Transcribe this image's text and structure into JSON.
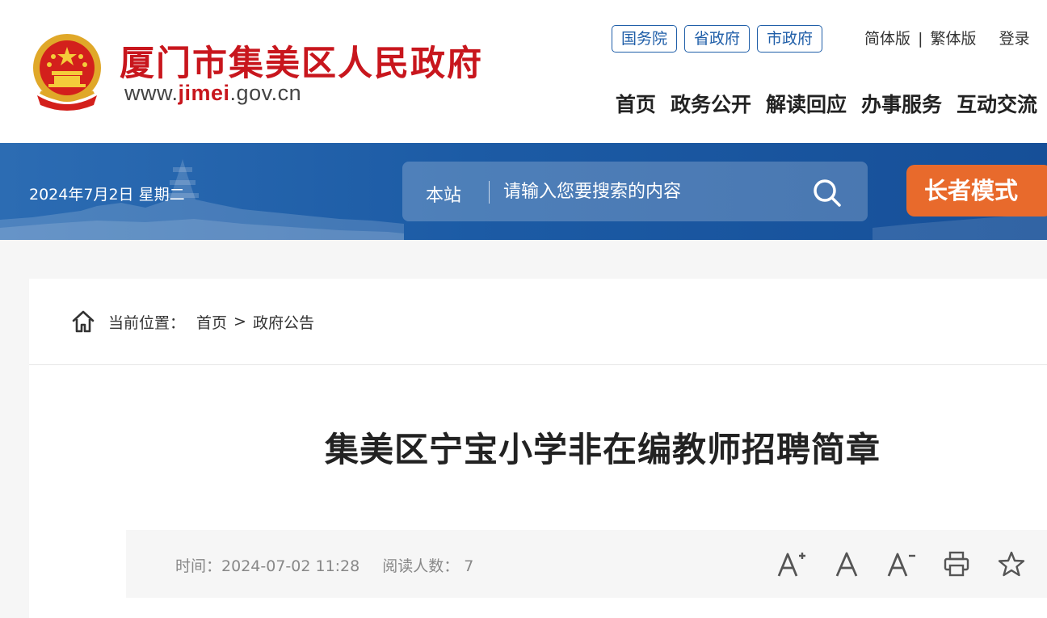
{
  "header": {
    "title": "厦门市集美区人民政府",
    "url_prefix": "www.",
    "url_highlight": "jimei",
    "url_suffix": ".gov.cn",
    "emblem": "national-emblem",
    "gov_links": [
      "国务院",
      "省政府",
      "市政府"
    ],
    "lang_simplified": "简体版",
    "lang_separator": "|",
    "lang_traditional": "繁体版",
    "login": "登录",
    "nav": [
      "首页",
      "政务公开",
      "解读回应",
      "办事服务",
      "互动交流"
    ]
  },
  "banner": {
    "date": "2024年7月2日 星期二",
    "search_scope": "本站",
    "search_placeholder": "请输入您要搜索的内容",
    "search_icon": "search-icon",
    "elder_mode": "长者模式"
  },
  "breadcrumb": {
    "label": "当前位置：",
    "home": "首页",
    "arrow": ">",
    "current": "政府公告"
  },
  "article": {
    "title": "集美区宁宝小学非在编教师招聘简章",
    "time_label": "时间：",
    "time_value": "2024-07-02 11:28",
    "views_label": "阅读人数：",
    "views_value": "7",
    "tools": [
      "font-increase-icon",
      "font-default-icon",
      "font-decrease-icon",
      "print-icon",
      "favorite-star-icon"
    ]
  },
  "colors": {
    "brand_red": "#c8161d",
    "banner_blue": "#1c5ba5",
    "link_blue": "#1f5ea8",
    "elder_orange": "#e86a2c"
  }
}
